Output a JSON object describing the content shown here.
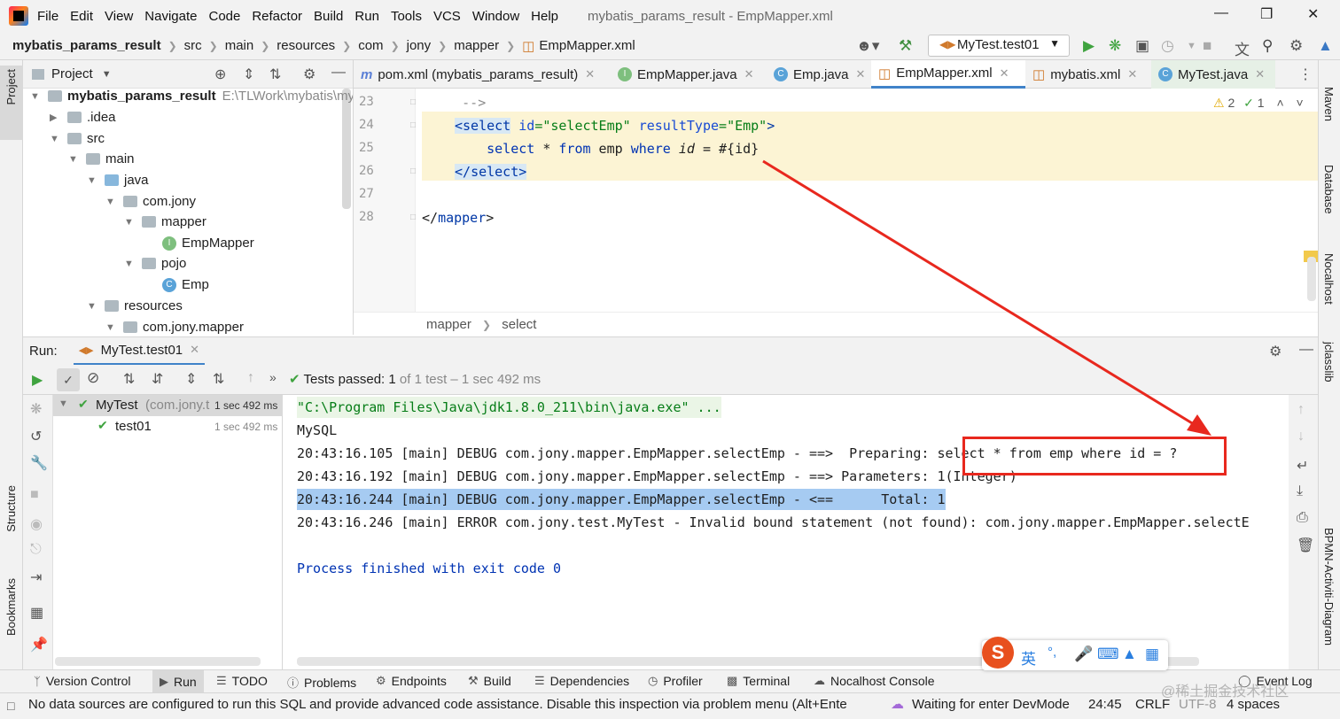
{
  "menubar": {
    "items": [
      "File",
      "Edit",
      "View",
      "Navigate",
      "Code",
      "Refactor",
      "Build",
      "Run",
      "Tools",
      "VCS",
      "Window",
      "Help"
    ],
    "window_title": "mybatis_params_result - EmpMapper.xml"
  },
  "navbar": {
    "crumbs": [
      "mybatis_params_result",
      "src",
      "main",
      "resources",
      "com",
      "jony",
      "mapper",
      "EmpMapper.xml"
    ],
    "run_config": "MyTest.test01"
  },
  "left_strip": {
    "project": "Project",
    "structure": "Structure",
    "bookmarks": "Bookmarks"
  },
  "right_strip": {
    "maven": "Maven",
    "database": "Database",
    "nocalhost": "Nocalhost",
    "jclasslib": "jclasslib",
    "bpmn": "BPMN-Activiti-Diagram"
  },
  "project_panel": {
    "title": "Project",
    "root_name": "mybatis_params_result",
    "root_path": "E:\\TLWork\\mybatis\\my",
    "items": [
      ".idea",
      "src",
      "main",
      "java",
      "com.jony",
      "mapper",
      "EmpMapper",
      "pojo",
      "Emp",
      "resources",
      "com.jony.mapper"
    ]
  },
  "editor_tabs": [
    "pom.xml (mybatis_params_result)",
    "EmpMapper.java",
    "Emp.java",
    "EmpMapper.xml",
    "mybatis.xml",
    "MyTest.java"
  ],
  "editor": {
    "line_numbers": [
      "23",
      "24",
      "25",
      "26",
      "27",
      "28"
    ],
    "line23": "-->",
    "line24": {
      "open": "<",
      "tag": "select",
      "a1": "id",
      "eq1": "=",
      "v1": "\"selectEmp\"",
      "a2": "resultType",
      "eq2": "=",
      "v2": "\"Emp\"",
      "close": ">"
    },
    "line25": {
      "k1": "select",
      "t1": " * ",
      "k2": "from",
      "t2": " emp ",
      "k3": "where",
      "t3": " ",
      "k4": "id",
      "t4": " = #{id}"
    },
    "line26": {
      "open": "</",
      "tag": "select",
      "close": ">"
    },
    "line28": {
      "open": "</",
      "tag": "mapper",
      "close": ">"
    },
    "warnings": "2",
    "ok_count": "1",
    "breadcrumbs": [
      "mapper",
      "select"
    ]
  },
  "run_panel": {
    "label": "Run:",
    "tab": "MyTest.test01",
    "tests_passed_label": "Tests passed:",
    "tests_passed_count": "1",
    "tests_passed_detail": "of 1 test – 1 sec 492 ms",
    "tree": [
      {
        "name": "MyTest",
        "detail": "(com.jony.t",
        "time": "1 sec 492 ms"
      },
      {
        "name": "test01",
        "detail": "",
        "time": "1 sec 492 ms"
      }
    ],
    "console": [
      "\"C:\\Program Files\\Java\\jdk1.8.0_211\\bin\\java.exe\" ...",
      "MySQL",
      "20:43:16.105 [main] DEBUG com.jony.mapper.EmpMapper.selectEmp - ==>  Preparing: select * from emp where id = ?",
      "20:43:16.192 [main] DEBUG com.jony.mapper.EmpMapper.selectEmp - ==> Parameters: 1(Integer)",
      "20:43:16.244 [main] DEBUG com.jony.mapper.EmpMapper.selectEmp - <==      Total: 1",
      "20:43:16.246 [main] ERROR com.jony.test.MyTest - Invalid bound statement (not found): com.jony.mapper.EmpMapper.selectE",
      "",
      "Process finished with exit code 0"
    ]
  },
  "tool_tabs": [
    "Version Control",
    "Run",
    "TODO",
    "Problems",
    "Endpoints",
    "Build",
    "Dependencies",
    "Profiler",
    "Terminal",
    "Nocalhost Console",
    "Event Log"
  ],
  "status_bar": {
    "message": "No data sources are configured to run this SQL and provide advanced code assistance. Disable this inspection via problem menu (Alt+Ente",
    "devmode": "Waiting for enter DevMode",
    "position": "24:45",
    "line_sep": "CRLF",
    "encoding": "UTF-8",
    "indent": "4 spaces"
  },
  "ime": {
    "lang": "英",
    "punct": "°,"
  },
  "watermark": "@稀土掘金技术社区"
}
